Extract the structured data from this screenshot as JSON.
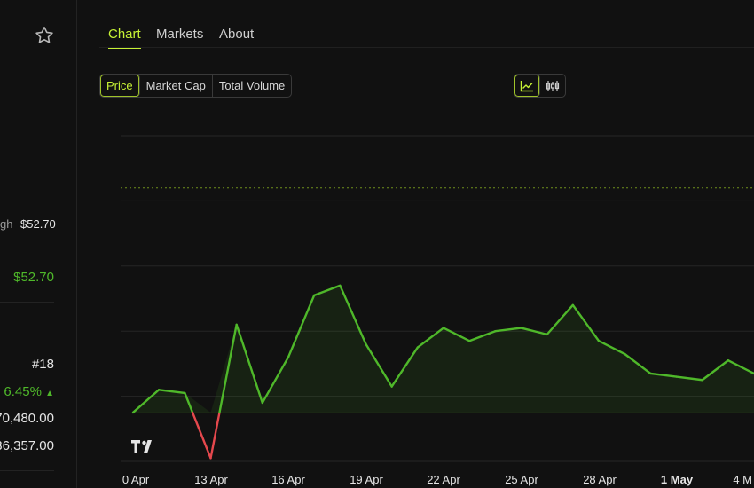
{
  "left_panel": {
    "high_label_partial": "gh",
    "high_value": "$52.70",
    "price_value": "$52.70",
    "rank": "#18",
    "change": "6.45%",
    "change_arrow": "▲",
    "value_1": "70,480.00",
    "value_2": "36,357.00"
  },
  "tabs": [
    {
      "label": "Chart",
      "active": true
    },
    {
      "label": "Markets",
      "active": false
    },
    {
      "label": "About",
      "active": false
    }
  ],
  "metric_toggle": [
    {
      "label": "Price",
      "active": true
    },
    {
      "label": "Market Cap",
      "active": false
    },
    {
      "label": "Total Volume",
      "active": false
    }
  ],
  "chart_type_toggle": [
    {
      "icon": "line-chart-icon",
      "active": true
    },
    {
      "icon": "candlestick-icon",
      "active": false
    }
  ],
  "colors": {
    "accent": "#c6f135",
    "up": "#4fb82a",
    "down": "#e5484d",
    "grid": "#262626"
  },
  "chart_data": {
    "type": "line",
    "x_tick_labels": [
      "0 Apr",
      "13 Apr",
      "16 Apr",
      "19 Apr",
      "22 Apr",
      "25 Apr",
      "28 Apr",
      "1 May",
      "4 M"
    ],
    "x_tick_bold": [
      false,
      false,
      false,
      false,
      false,
      false,
      false,
      true,
      false
    ],
    "y_range": [
      0,
      100
    ],
    "reference_level": 84,
    "baseline_level": 15,
    "grid": true,
    "series": [
      {
        "values": [
          15,
          22,
          21,
          1,
          42,
          18,
          32,
          51,
          54,
          36,
          23,
          35,
          41,
          37,
          40,
          41,
          39,
          48,
          37,
          33,
          27,
          26,
          25,
          31,
          27
        ]
      }
    ],
    "watermark": "TV"
  }
}
